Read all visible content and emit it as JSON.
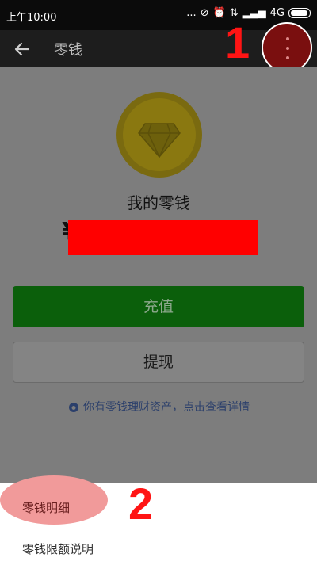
{
  "status_bar": {
    "time": "上午10:00",
    "network": "4G",
    "dots": "..."
  },
  "header": {
    "title": "零钱"
  },
  "annotations": {
    "step1": "1",
    "step2": "2"
  },
  "wallet": {
    "label": "我的零钱",
    "currency_symbol": "¥"
  },
  "buttons": {
    "recharge": "充值",
    "withdraw": "提现"
  },
  "info_text": "你有零钱理财资产，点击查看详情",
  "menu": {
    "items": [
      {
        "label": "零钱明细"
      },
      {
        "label": "零钱限额说明"
      }
    ]
  },
  "colors": {
    "accent_red": "#ff1414",
    "green_button": "#0b5f0b",
    "coin_gold": "#8a7810"
  }
}
